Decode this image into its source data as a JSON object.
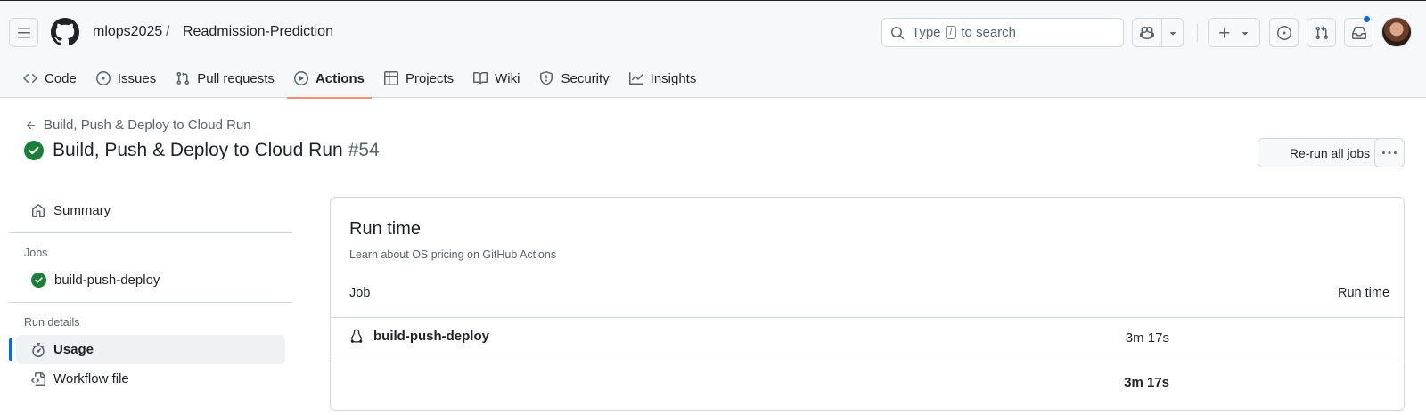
{
  "repo": {
    "owner": "mlops2025",
    "separator": "/",
    "name": "Readmission-Prediction"
  },
  "search": {
    "prefix": "Type",
    "key": "/",
    "suffix": "to search"
  },
  "tabs": [
    {
      "label": "Code",
      "icon": "code-icon"
    },
    {
      "label": "Issues",
      "icon": "issue-opened-icon"
    },
    {
      "label": "Pull requests",
      "icon": "git-pull-request-icon"
    },
    {
      "label": "Actions",
      "icon": "play-icon",
      "active": true
    },
    {
      "label": "Projects",
      "icon": "table-icon"
    },
    {
      "label": "Wiki",
      "icon": "book-icon"
    },
    {
      "label": "Security",
      "icon": "shield-icon"
    },
    {
      "label": "Insights",
      "icon": "graph-icon"
    }
  ],
  "run": {
    "back_label": "Build, Push & Deploy to Cloud Run",
    "title": "Build, Push & Deploy to Cloud Run",
    "number": "#54",
    "status": "success",
    "rerun_label": "Re-run all jobs"
  },
  "sidebar": {
    "summary": "Summary",
    "jobs_heading": "Jobs",
    "job_name": "build-push-deploy",
    "run_details_heading": "Run details",
    "usage": "Usage",
    "workflow_file": "Workflow file"
  },
  "usage": {
    "title": "Run time",
    "subtitle": "Learn about OS pricing on GitHub Actions",
    "col_job": "Job",
    "col_time": "Run time",
    "rows": [
      {
        "job": "build-push-deploy",
        "os_icon": "linux-icon",
        "time": "3m 17s"
      }
    ],
    "total": "3m 17s"
  },
  "colors": {
    "accent": "#0969da",
    "success": "#1a7f37",
    "tab_underline": "#fd8c73",
    "notification_dot": "#0969da"
  }
}
